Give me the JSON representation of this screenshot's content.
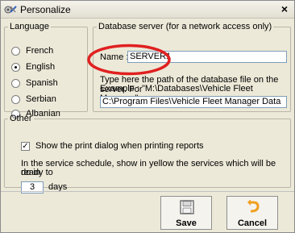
{
  "window": {
    "title": "Personalize",
    "close_glyph": "×",
    "icon": "settings-icon"
  },
  "language": {
    "legend": "Language",
    "options": [
      "French",
      "English",
      "Spanish",
      "Serbian",
      "Albanian"
    ],
    "selected": "English"
  },
  "database": {
    "legend": "Database server (for a network access only)",
    "name_label": "Name :",
    "name_value": "SERVER1",
    "help_text_line1": "Type here the path of the database file on the server. For",
    "help_text_line2": "Example : \"M:\\Databases\\Vehicle Fleet Manager\"",
    "path_value": "C:\\Program Files\\Vehicle Fleet Manager Data"
  },
  "other": {
    "legend": "Other",
    "print_dialog_label": "Show the print dialog when printing reports",
    "print_dialog_checked": true,
    "check_glyph": "✓",
    "schedule_text_line1": "In the service schedule, show in yellow the services which will be ready to",
    "schedule_text_line2": "do in",
    "days_value": "3",
    "days_label": "days"
  },
  "buttons": {
    "save_label": "Save",
    "save_icon": "floppy-disk-icon",
    "cancel_label": "Cancel",
    "cancel_icon": "undo-arrow-icon"
  },
  "colors": {
    "highlight_circle": "#e02020",
    "accent_orange": "#f0a020"
  }
}
